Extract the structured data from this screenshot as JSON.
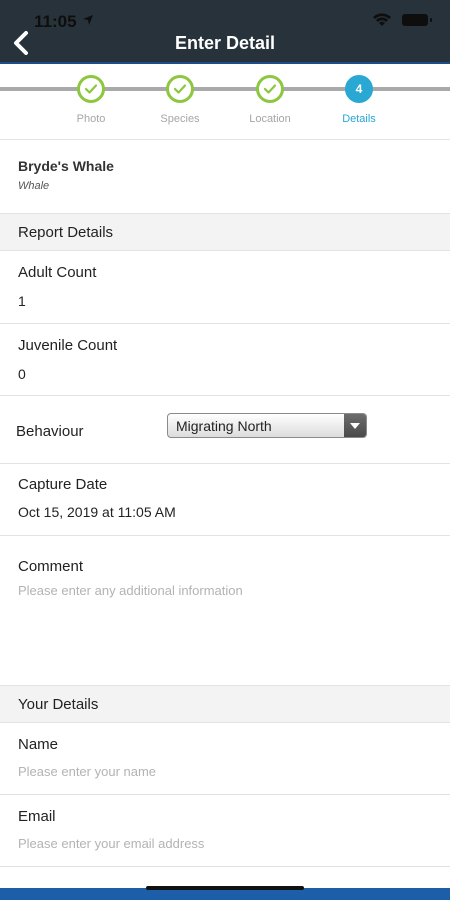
{
  "status_bar": {
    "time": "11:05"
  },
  "nav": {
    "title": "Enter Detail"
  },
  "steps": [
    {
      "label": "Photo",
      "state": "complete"
    },
    {
      "label": "Species",
      "state": "complete"
    },
    {
      "label": "Location",
      "state": "complete"
    },
    {
      "label": "Details",
      "number": "4",
      "state": "active"
    }
  ],
  "species": {
    "name": "Bryde's Whale",
    "type": "Whale"
  },
  "report_details": {
    "section_title": "Report Details",
    "adult_count": {
      "label": "Adult Count",
      "value": "1"
    },
    "juvenile_count": {
      "label": "Juvenile Count",
      "value": "0"
    },
    "behaviour": {
      "label": "Behaviour",
      "selected": "Migrating North"
    },
    "capture_date": {
      "label": "Capture Date",
      "value": "Oct 15, 2019 at 11:05 AM"
    },
    "comment": {
      "label": "Comment",
      "placeholder": "Please enter any additional information"
    }
  },
  "your_details": {
    "section_title": "Your Details",
    "name": {
      "label": "Name",
      "placeholder": "Please enter your name"
    },
    "email": {
      "label": "Email",
      "placeholder": "Please enter your email address"
    }
  },
  "colors": {
    "nav_bg": "#27323a",
    "step_complete": "#8dc63f",
    "step_active": "#29a8d3",
    "bottom_bar": "#1c5fa8"
  }
}
